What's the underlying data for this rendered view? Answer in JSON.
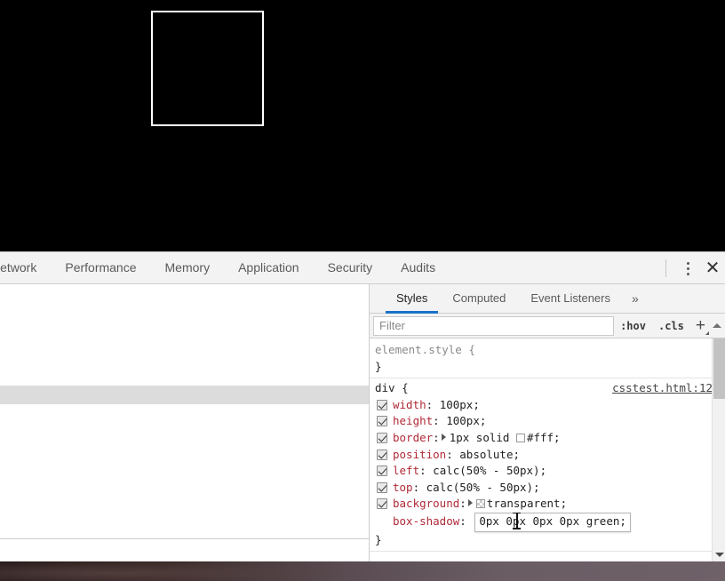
{
  "viewport": {
    "background_color": "#000000",
    "test_box": {
      "name": "test-div",
      "border_color": "#ffffff"
    }
  },
  "devtools": {
    "main_tabs": [
      {
        "label": "Network",
        "active": false
      },
      {
        "label": "Performance",
        "active": false
      },
      {
        "label": "Memory",
        "active": false
      },
      {
        "label": "Application",
        "active": false
      },
      {
        "label": "Security",
        "active": false
      },
      {
        "label": "Audits",
        "active": false
      }
    ],
    "toolbar_right": {
      "more_label": "⋮",
      "close_label": "✕"
    },
    "sidebar": {
      "tabs": [
        {
          "label": "Styles",
          "active": true
        },
        {
          "label": "Computed",
          "active": false
        },
        {
          "label": "Event Listeners",
          "active": false
        }
      ],
      "more_tabs_label": "»",
      "filter": {
        "placeholder": "Filter",
        "value": ""
      },
      "buttons": {
        "hov": ":hov",
        "cls": ".cls",
        "new_rule": "+"
      },
      "rules": [
        {
          "selector": "element.style {",
          "selector_muted": true,
          "source": "",
          "declarations": [],
          "close_brace": "}"
        },
        {
          "selector": "div {",
          "selector_muted": false,
          "source": "csstest.html:12",
          "declarations": [
            {
              "enabled": true,
              "property": "width",
              "value": "100px;",
              "expander": false,
              "swatch": "none"
            },
            {
              "enabled": true,
              "property": "height",
              "value": "100px;",
              "expander": false,
              "swatch": "none"
            },
            {
              "enabled": true,
              "property": "border",
              "value": "1px solid #fff;",
              "expander": true,
              "swatch": "white",
              "value_pre": "1px solid ",
              "swatch_text": "#fff;"
            },
            {
              "enabled": true,
              "property": "position",
              "value": "absolute;",
              "expander": false,
              "swatch": "none"
            },
            {
              "enabled": true,
              "property": "left",
              "value": "calc(50% - 50px);",
              "expander": false,
              "swatch": "none"
            },
            {
              "enabled": true,
              "property": "top",
              "value": "calc(50% - 50px);",
              "expander": false,
              "swatch": "none"
            },
            {
              "enabled": true,
              "property": "background",
              "value": "transparent;",
              "expander": true,
              "swatch": "checker",
              "value_pre": "",
              "swatch_text": "transparent;"
            },
            {
              "enabled": false,
              "property": "box-shadow",
              "value": "0px 0px 0px 0px green;",
              "editing": true,
              "expander": false,
              "swatch": "none"
            }
          ],
          "close_brace": "}"
        }
      ]
    }
  },
  "colors": {
    "accent": "#1a73c8",
    "property": "#b02a37",
    "chrome_bg": "#f3f3f3",
    "selected_row": "#dcdcdc"
  }
}
